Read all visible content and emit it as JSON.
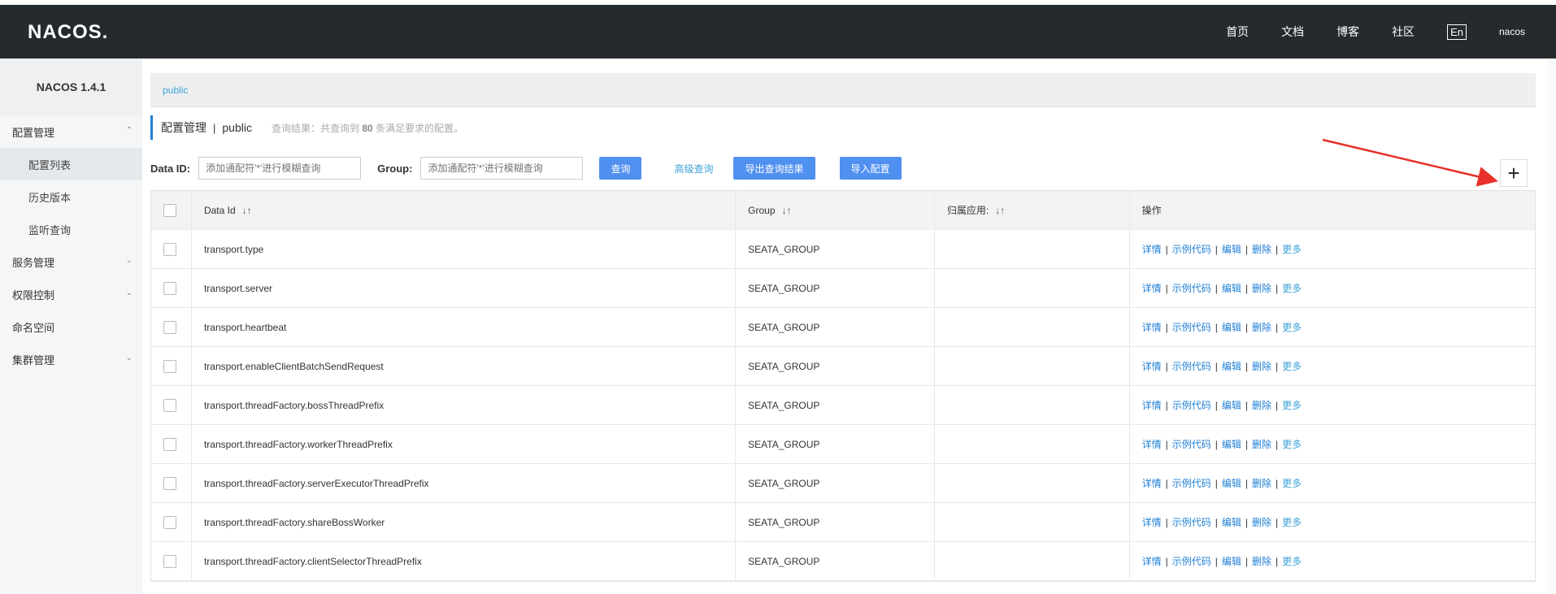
{
  "header": {
    "logo": "NACOS.",
    "nav": [
      "首页",
      "文档",
      "博客",
      "社区"
    ],
    "lang": "En",
    "user": "nacos"
  },
  "sidebar": {
    "title": "NACOS 1.4.1",
    "items": [
      {
        "label": "配置管理",
        "chevron": "up"
      },
      {
        "label": "配置列表",
        "sub": true,
        "active": true
      },
      {
        "label": "历史版本",
        "sub": true
      },
      {
        "label": "监听查询",
        "sub": true
      },
      {
        "label": "服务管理",
        "chevron": "down"
      },
      {
        "label": "权限控制",
        "chevron": "down"
      },
      {
        "label": "命名空间"
      },
      {
        "label": "集群管理",
        "chevron": "down"
      }
    ]
  },
  "breadcrumb": "public",
  "page": {
    "title": "配置管理",
    "separator": "|",
    "namespace": "public",
    "result_prefix": "查询结果：共查询到",
    "result_count": "80",
    "result_suffix": "条满足要求的配置。"
  },
  "filters": {
    "dataid_label": "Data ID:",
    "dataid_placeholder": "添加通配符'*'进行模糊查询",
    "group_label": "Group:",
    "group_placeholder": "添加通配符'*'进行模糊查询",
    "query": "查询",
    "advanced": "高级查询",
    "export": "导出查询结果",
    "import": "导入配置"
  },
  "plus": "+",
  "table": {
    "headers": [
      "Data Id",
      "Group",
      "归属应用:",
      "操作"
    ],
    "ops": [
      "详情",
      "示例代码",
      "编辑",
      "删除",
      "更多"
    ],
    "rows": [
      {
        "dataId": "transport.type",
        "group": "SEATA_GROUP",
        "app": ""
      },
      {
        "dataId": "transport.server",
        "group": "SEATA_GROUP",
        "app": ""
      },
      {
        "dataId": "transport.heartbeat",
        "group": "SEATA_GROUP",
        "app": ""
      },
      {
        "dataId": "transport.enableClientBatchSendRequest",
        "group": "SEATA_GROUP",
        "app": ""
      },
      {
        "dataId": "transport.threadFactory.bossThreadPrefix",
        "group": "SEATA_GROUP",
        "app": ""
      },
      {
        "dataId": "transport.threadFactory.workerThreadPrefix",
        "group": "SEATA_GROUP",
        "app": ""
      },
      {
        "dataId": "transport.threadFactory.serverExecutorThreadPrefix",
        "group": "SEATA_GROUP",
        "app": ""
      },
      {
        "dataId": "transport.threadFactory.shareBossWorker",
        "group": "SEATA_GROUP",
        "app": ""
      },
      {
        "dataId": "transport.threadFactory.clientSelectorThreadPrefix",
        "group": "SEATA_GROUP",
        "app": ""
      }
    ]
  },
  "colors": {
    "header_bg": "#252a2f",
    "primary": "#5090f0",
    "link": "#3fa2d8",
    "arrow": "#e8312a"
  }
}
